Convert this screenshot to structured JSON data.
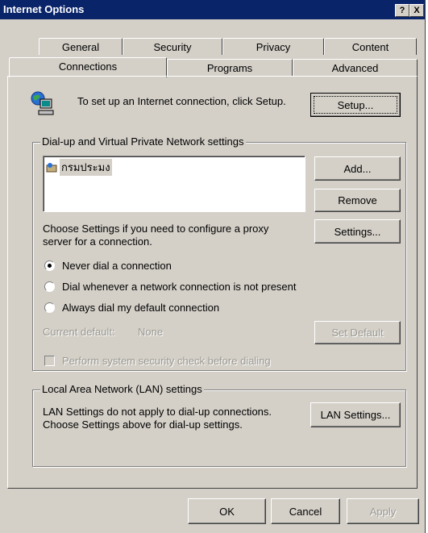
{
  "window": {
    "title": "Internet Options",
    "help_btn": "?",
    "close_btn": "X"
  },
  "tabs": {
    "row1": [
      "General",
      "Security",
      "Privacy",
      "Content"
    ],
    "row2": [
      "Connections",
      "Programs",
      "Advanced"
    ],
    "selected": "Connections"
  },
  "setup": {
    "text": "To set up an Internet connection, click Setup.",
    "button": "Setup..."
  },
  "dialup": {
    "group_label": "Dial-up and Virtual Private Network settings",
    "connections": [
      "กรมประมง"
    ],
    "add_button": "Add...",
    "remove_button": "Remove",
    "proxy_text": "Choose Settings if you need to configure a proxy server for a connection.",
    "settings_button": "Settings...",
    "radio_never": "Never dial a connection",
    "radio_whenever": "Dial whenever a network connection is not present",
    "radio_always": "Always dial my default connection",
    "selected_option": "Never dial a connection",
    "current_default_label": "Current default:",
    "current_default_value": "None",
    "set_default_button": "Set Default",
    "security_check": "Perform system security check before dialing"
  },
  "lan": {
    "group_label": "Local Area Network (LAN) settings",
    "text": "LAN Settings do not apply to dial-up connections. Choose Settings above for dial-up settings.",
    "button": "LAN Settings..."
  },
  "footer": {
    "ok": "OK",
    "cancel": "Cancel",
    "apply": "Apply"
  },
  "colors": {
    "titlebar": "#0a246a",
    "face": "#d4d0c8",
    "disabled_text": "#9a9890"
  }
}
